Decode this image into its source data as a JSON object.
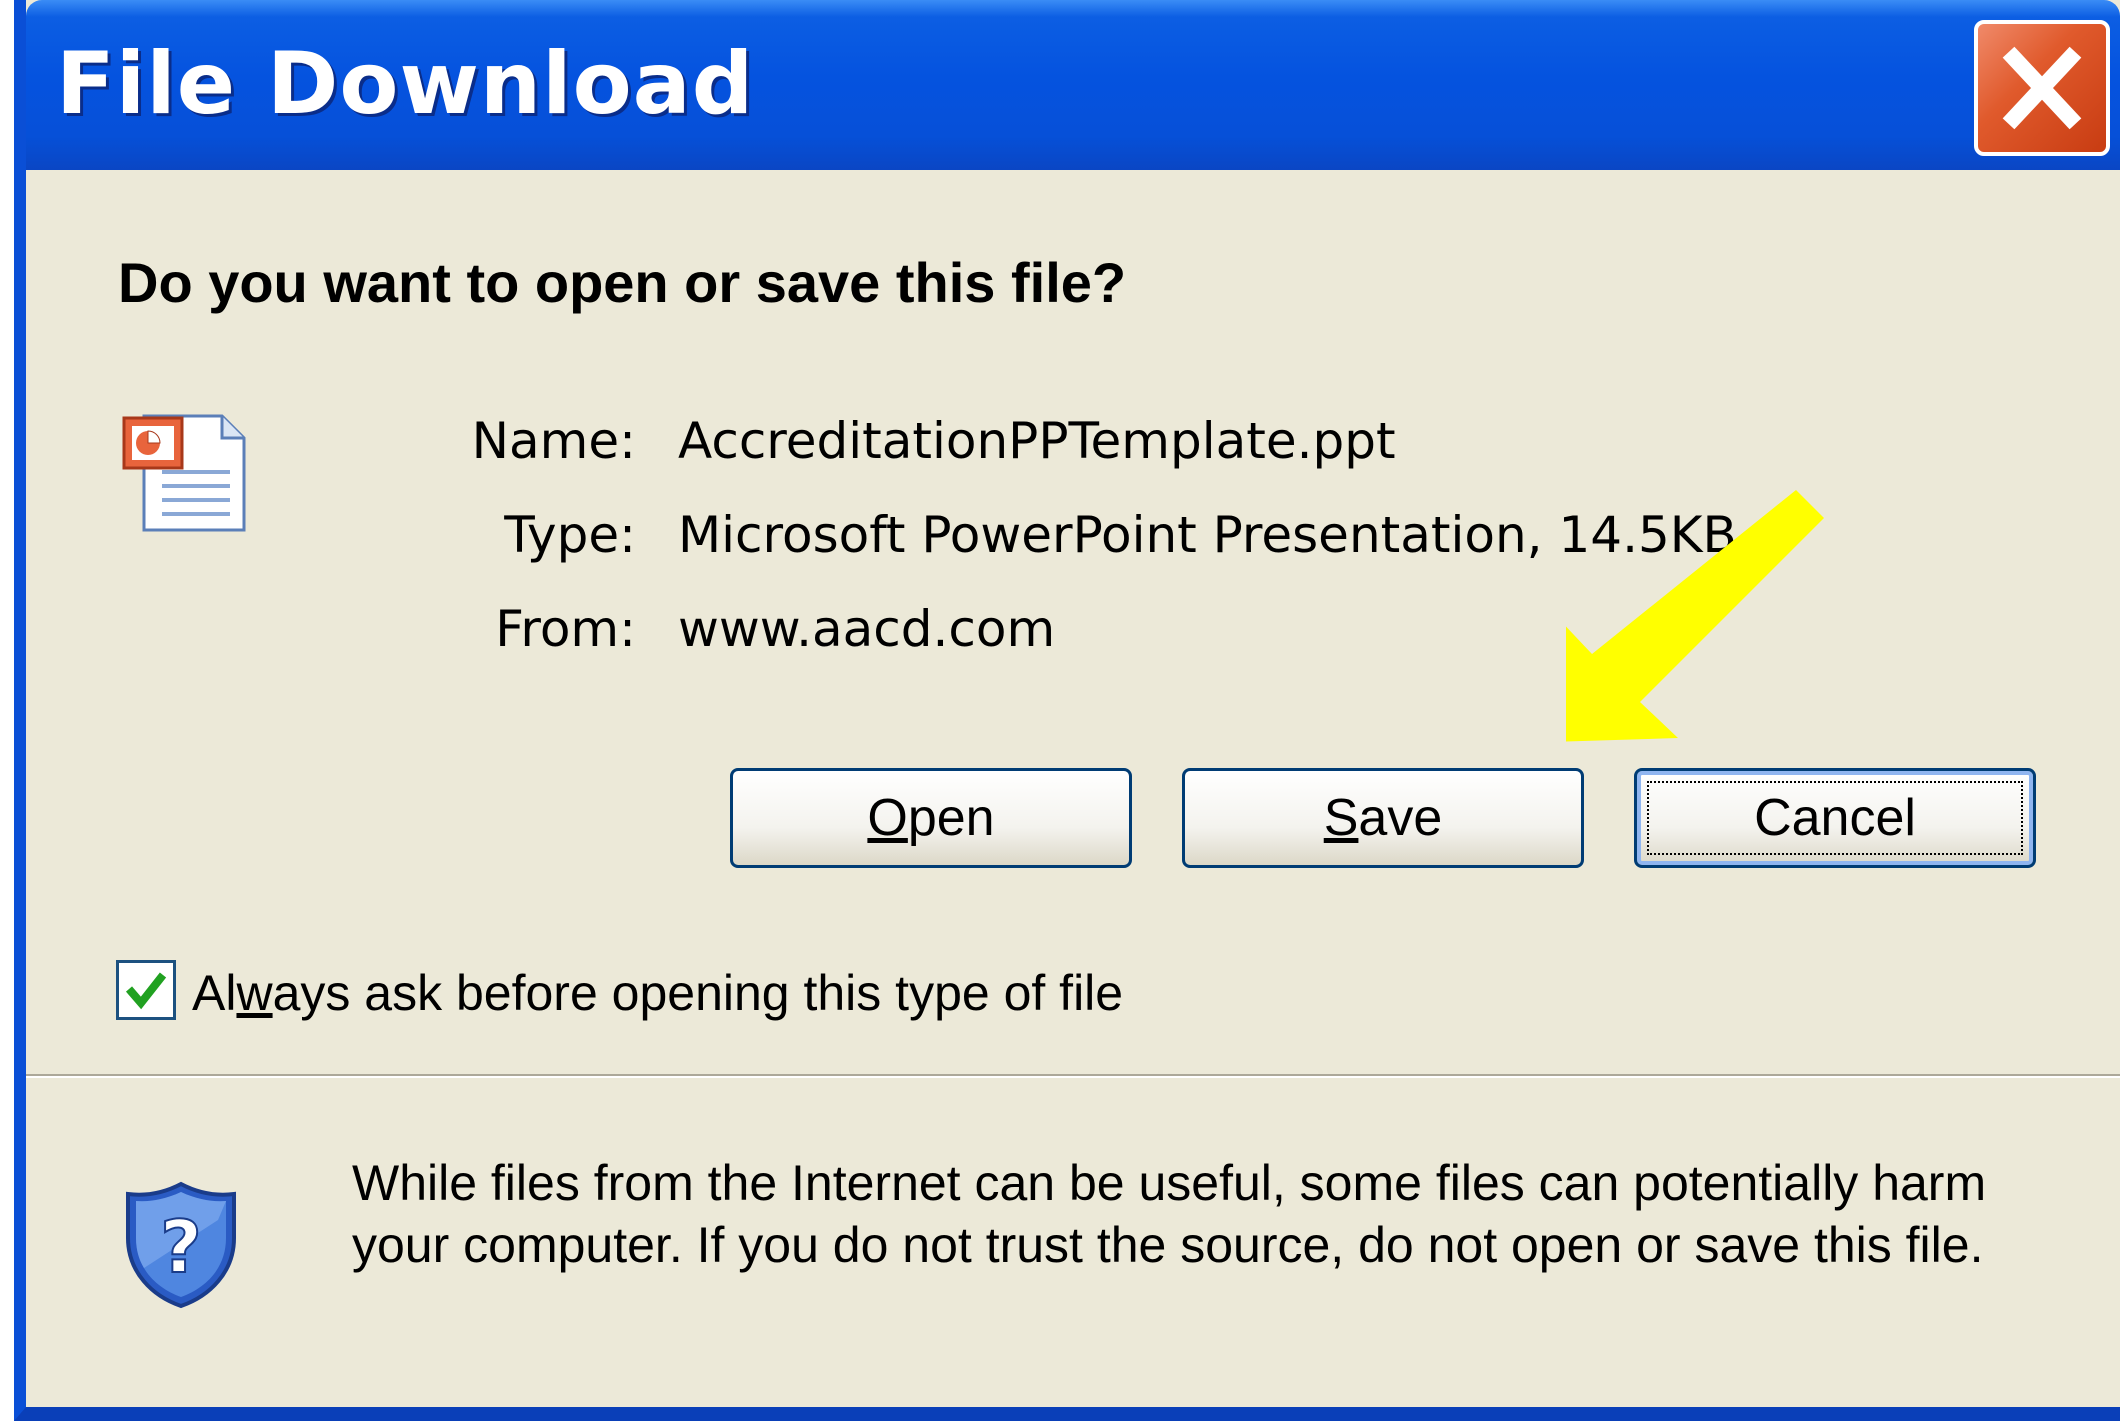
{
  "window": {
    "title": "File Download"
  },
  "dialog": {
    "question": "Do you want to open or save this file?",
    "file": {
      "name_label": "Name:",
      "name_value": "AccreditationPPTemplate.ppt",
      "type_label": "Type:",
      "type_value": "Microsoft PowerPoint Presentation, 14.5KB",
      "from_label": "From:",
      "from_value": "www.aacd.com",
      "icon": "powerpoint-file-icon"
    },
    "buttons": {
      "open_key": "O",
      "open_rest": "pen",
      "save_key": "S",
      "save_rest": "ave",
      "cancel": "Cancel"
    },
    "checkbox": {
      "checked": true,
      "label_before": "Al",
      "label_key": "w",
      "label_after": "ays ask before opening this type of file"
    },
    "warning": {
      "icon": "shield-question-icon",
      "text": "While files from the Internet can be useful, some files can potentially harm your computer. If you do not trust the source, do not open or save this file."
    }
  },
  "annotation": {
    "arrow_color": "#ffff00",
    "points_to": "Save"
  },
  "colors": {
    "titlebar": "#0553df",
    "dialog_bg": "#ece9d8",
    "close_button": "#e05a2c",
    "button_border": "#003c74"
  }
}
